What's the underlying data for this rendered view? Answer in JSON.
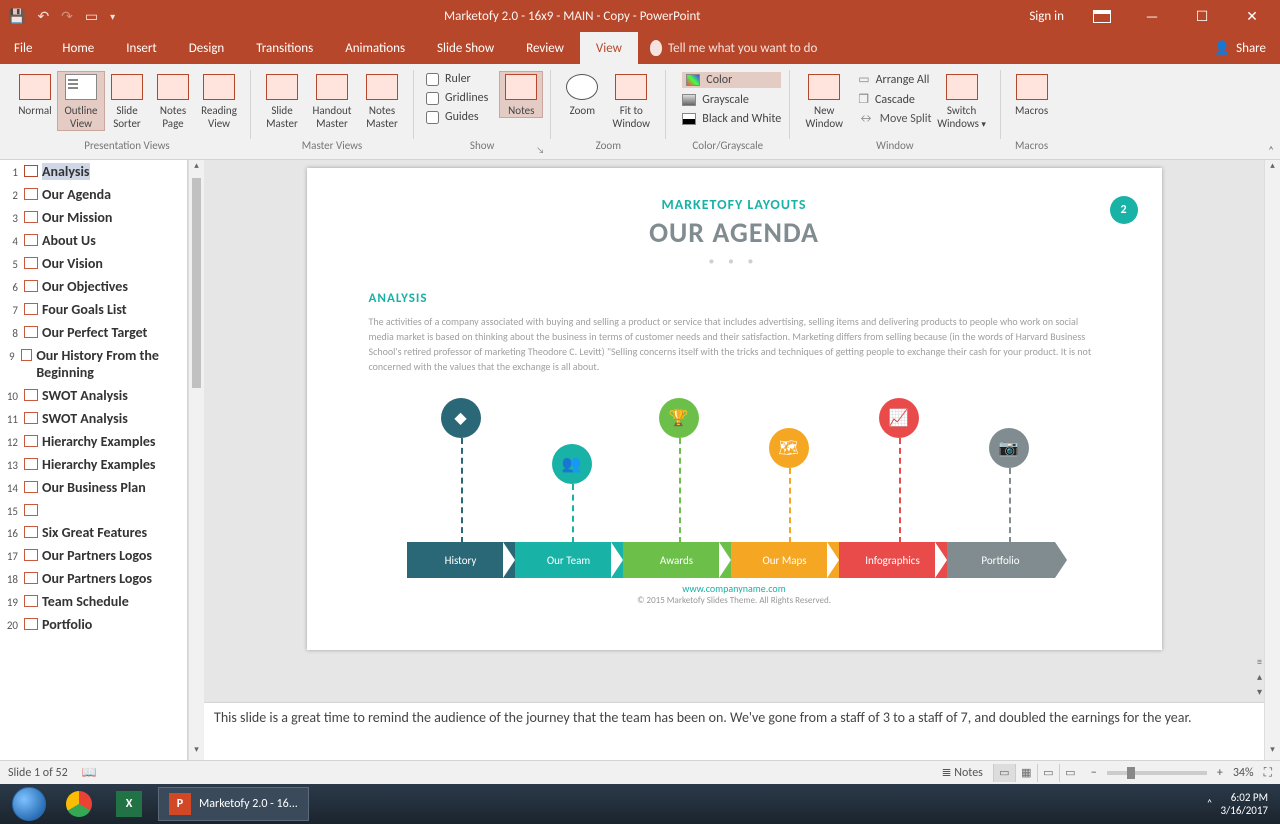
{
  "titlebar": {
    "title": "Marketofy 2.0 - 16x9 - MAIN - Copy - PowerPoint",
    "signin": "Sign in"
  },
  "tabs": {
    "file": "File",
    "home": "Home",
    "insert": "Insert",
    "design": "Design",
    "transitions": "Transitions",
    "animations": "Animations",
    "slideshow": "Slide Show",
    "review": "Review",
    "view": "View",
    "tell_me": "Tell me what you want to do",
    "share": "Share"
  },
  "ribbon": {
    "presentation_views": {
      "group": "Presentation Views",
      "normal": "Normal",
      "outline": "Outline View",
      "sorter": "Slide Sorter",
      "notes_page": "Notes Page",
      "reading": "Reading View"
    },
    "master_views": {
      "group": "Master Views",
      "slide_master": "Slide Master",
      "handout_master": "Handout Master",
      "notes_master": "Notes Master"
    },
    "show": {
      "group": "Show",
      "ruler": "Ruler",
      "gridlines": "Gridlines",
      "guides": "Guides",
      "notes": "Notes"
    },
    "zoom": {
      "group": "Zoom",
      "zoom": "Zoom",
      "fit": "Fit to Window"
    },
    "cg": {
      "group": "Color/Grayscale",
      "color": "Color",
      "grayscale": "Grayscale",
      "bw": "Black and White"
    },
    "window": {
      "group": "Window",
      "new_window": "New Window",
      "arrange": "Arrange All",
      "cascade": "Cascade",
      "move_split": "Move Split",
      "switch": "Switch Windows"
    },
    "macros": {
      "group": "Macros",
      "macros": "Macros"
    }
  },
  "outline": {
    "items": [
      {
        "n": "1",
        "t": "Analysis",
        "sel": true
      },
      {
        "n": "2",
        "t": "Our Agenda"
      },
      {
        "n": "3",
        "t": "Our Mission"
      },
      {
        "n": "4",
        "t": "About Us"
      },
      {
        "n": "5",
        "t": "Our Vision"
      },
      {
        "n": "6",
        "t": "Our Objectives"
      },
      {
        "n": "7",
        "t": "Four Goals List"
      },
      {
        "n": "8",
        "t": "Our Perfect Target"
      },
      {
        "n": "9",
        "t": "Our History From the Beginning"
      },
      {
        "n": "10",
        "t": "SWOT Analysis"
      },
      {
        "n": "11",
        "t": "SWOT Analysis"
      },
      {
        "n": "12",
        "t": "Hierarchy Examples"
      },
      {
        "n": "13",
        "t": "Hierarchy Examples"
      },
      {
        "n": "14",
        "t": "Our Business Plan"
      },
      {
        "n": "15",
        "t": ""
      },
      {
        "n": "16",
        "t": "Six Great Features"
      },
      {
        "n": "17",
        "t": "Our Partners Logos"
      },
      {
        "n": "18",
        "t": "Our Partners Logos"
      },
      {
        "n": "19",
        "t": "Team Schedule"
      },
      {
        "n": "20",
        "t": "Portfolio"
      }
    ]
  },
  "slide": {
    "badge": "2",
    "brand": "MARKETOFY LAYOUTS",
    "title": "OUR AGENDA",
    "section": "ANALYSIS",
    "body": "The activities of a company associated with buying and selling a product or service that includes advertising, selling items and delivering products to people who work on social media market is based on thinking about the business in terms of customer needs and their satisfaction. Marketing differs from selling because (in the words of Harvard Business School's retired professor of marketing Theodore C. Levitt) \"Selling concerns itself with the tricks and techniques of getting people to exchange their cash for your product. It is not concerned with the values that the exchange is all about.",
    "arrows": [
      "History",
      "Our Team",
      "Awards",
      "Our Maps",
      "Infographics",
      "Portfolio"
    ],
    "url": "www.companyname.com",
    "copyright": "© 2015 Marketofy Slides Theme. All Rights Reserved."
  },
  "notes": "This slide is a great time to remind the audience of the journey that the team has been on. We've gone from a staff of 3 to a staff of 7, and doubled the earnings for the year.",
  "status": {
    "slide": "Slide 1 of 52",
    "notes": "Notes",
    "zoom": "34%"
  },
  "taskbar": {
    "running": "Marketofy 2.0 - 16...",
    "time": "6:02 PM",
    "date": "3/16/2017"
  }
}
